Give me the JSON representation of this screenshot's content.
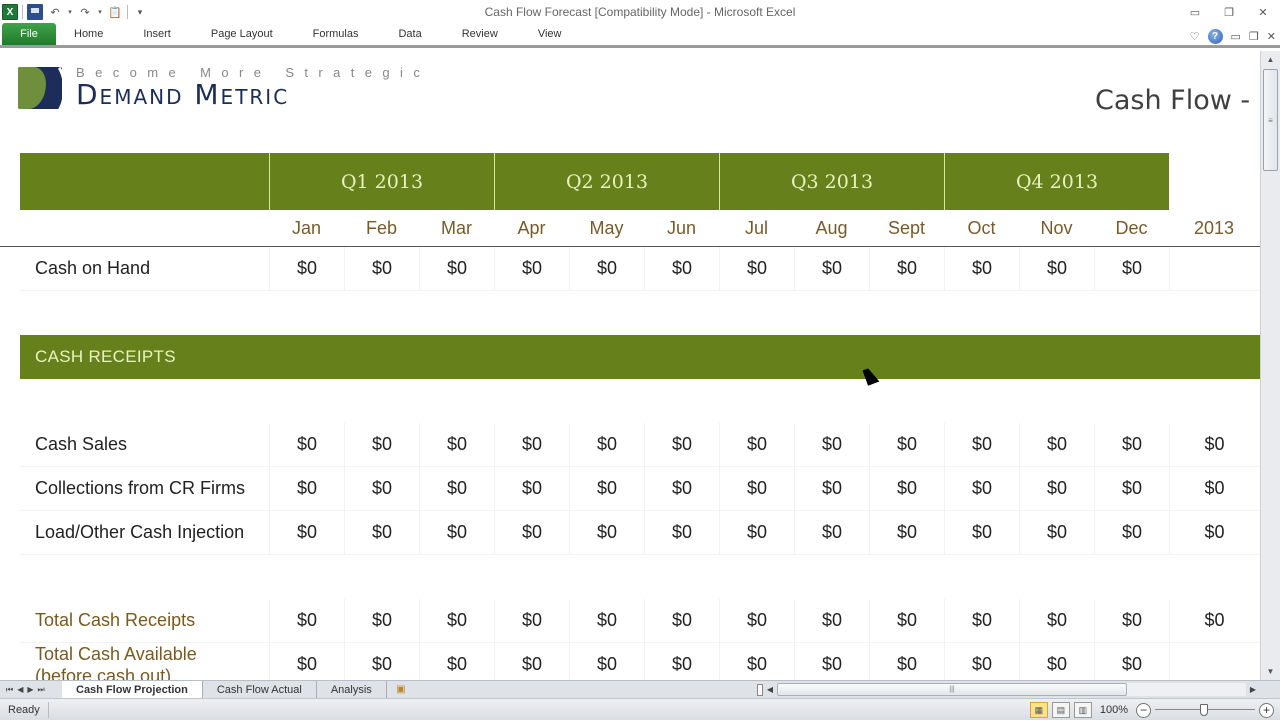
{
  "window": {
    "title": "Cash Flow Forecast  [Compatibility Mode]  -  Microsoft Excel",
    "controls": [
      "minimize",
      "restore",
      "close"
    ]
  },
  "quick_access": {
    "items": [
      "excel-logo",
      "save",
      "undo",
      "redo",
      "paste",
      "customize"
    ]
  },
  "ribbon": {
    "tabs": [
      "File",
      "Home",
      "Insert",
      "Page Layout",
      "Formulas",
      "Data",
      "Review",
      "View"
    ]
  },
  "logo": {
    "tagline": "Become More Strategic",
    "brand": "Demand Metric"
  },
  "page_title": "Cash Flow - P",
  "table": {
    "quarters": [
      "Q1 2013",
      "Q2 2013",
      "Q3 2013",
      "Q4 2013"
    ],
    "months": [
      "Jan",
      "Feb",
      "Mar",
      "Apr",
      "May",
      "Jun",
      "Jul",
      "Aug",
      "Sept",
      "Oct",
      "Nov",
      "Dec",
      "2013"
    ],
    "cash_on_hand": {
      "label": "Cash on Hand",
      "values": [
        "$0",
        "$0",
        "$0",
        "$0",
        "$0",
        "$0",
        "$0",
        "$0",
        "$0",
        "$0",
        "$0",
        "$0",
        ""
      ]
    },
    "section": "CASH RECEIPTS",
    "rows": [
      {
        "label": "Cash Sales",
        "values": [
          "$0",
          "$0",
          "$0",
          "$0",
          "$0",
          "$0",
          "$0",
          "$0",
          "$0",
          "$0",
          "$0",
          "$0",
          "$0"
        ]
      },
      {
        "label": "Collections from CR Firms",
        "values": [
          "$0",
          "$0",
          "$0",
          "$0",
          "$0",
          "$0",
          "$0",
          "$0",
          "$0",
          "$0",
          "$0",
          "$0",
          "$0"
        ]
      },
      {
        "label": "Load/Other Cash Injection",
        "values": [
          "$0",
          "$0",
          "$0",
          "$0",
          "$0",
          "$0",
          "$0",
          "$0",
          "$0",
          "$0",
          "$0",
          "$0",
          "$0"
        ]
      }
    ],
    "totals": [
      {
        "label": "Total Cash Receipts",
        "values": [
          "$0",
          "$0",
          "$0",
          "$0",
          "$0",
          "$0",
          "$0",
          "$0",
          "$0",
          "$0",
          "$0",
          "$0",
          "$0"
        ]
      },
      {
        "label": "Total Cash Available (before cash out)",
        "values": [
          "$0",
          "$0",
          "$0",
          "$0",
          "$0",
          "$0",
          "$0",
          "$0",
          "$0",
          "$0",
          "$0",
          "$0",
          ""
        ]
      }
    ]
  },
  "sheet_tabs": {
    "tabs": [
      "Cash Flow Projection",
      "Cash Flow Actual",
      "Analysis"
    ],
    "active": "Cash Flow Projection"
  },
  "status": {
    "text": "Ready",
    "zoom": "100%",
    "zoom_percent": 100
  },
  "colors": {
    "header_green": "#66811b",
    "header_text": "#e8f2c0",
    "month_text": "#7a5a2a",
    "brand_navy": "#1c2d5a"
  }
}
